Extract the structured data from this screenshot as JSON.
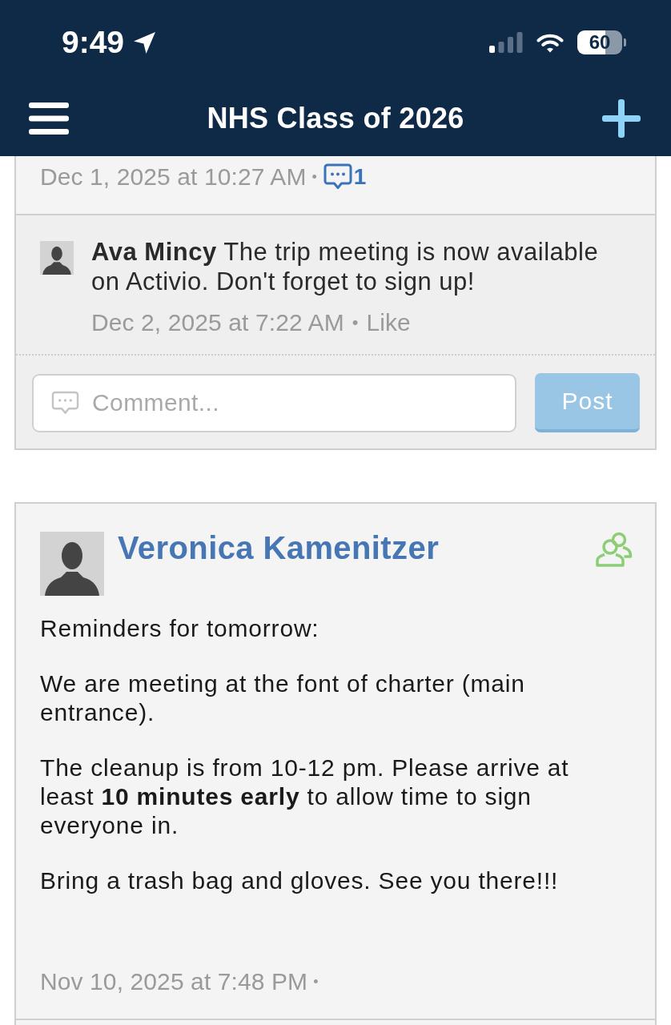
{
  "status_bar": {
    "time": "9:49",
    "battery": "60"
  },
  "nav_bar": {
    "title": "NHS Class of 2026"
  },
  "posts": [
    {
      "kind": "continued",
      "timestamp": "Dec 1, 2025 at 10:27 AM",
      "separator": "•",
      "comment_count": "1",
      "comments": [
        {
          "text": "**Ava Mincy** The trip meeting is now available on Activio. Don't forget to sign up!",
          "timestamp": "Dec 2, 2025 at 7:22 AM",
          "separator": "•",
          "like": "Like"
        }
      ],
      "comment_box": {
        "placeholder": "Comment..."
      },
      "post_button": "Post"
    },
    {
      "kind": "full",
      "author": "Veronica Kamenitzer",
      "paragraphs": [
        "Reminders for tomorrow:",
        "We are meeting at the font of charter (main entrance).",
        "The cleanup is from 10-12 pm. Please arrive at least **10 minutes early** to allow time to sign everyone in.",
        "Bring a trash bag and gloves. See you there!!!"
      ],
      "timestamp": "Nov 10, 2025 at 7:48 PM",
      "separator": "•"
    }
  ]
}
